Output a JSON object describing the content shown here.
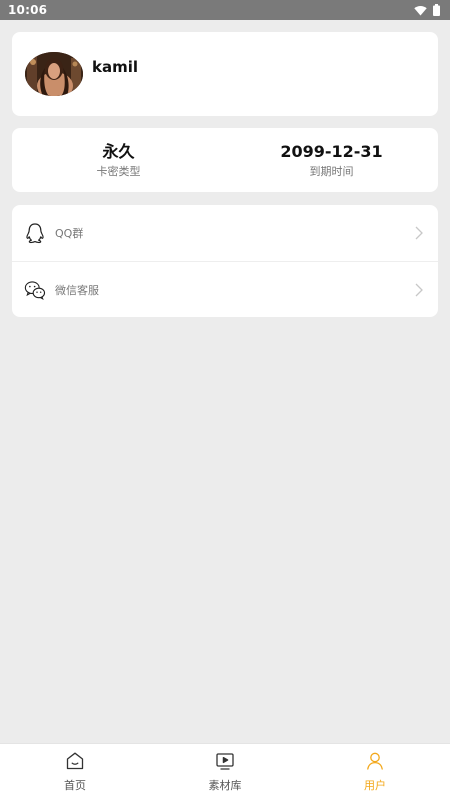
{
  "status_bar": {
    "time": "10:06"
  },
  "profile": {
    "username": "kamil"
  },
  "stats": [
    {
      "value": "永久",
      "label": "卡密类型"
    },
    {
      "value": "2099-12-31",
      "label": "到期时间"
    }
  ],
  "menu": [
    {
      "label": "QQ群",
      "icon": "qq-icon"
    },
    {
      "label": "微信客服",
      "icon": "wechat-icon"
    }
  ],
  "bottom_nav": [
    {
      "label": "首页",
      "icon": "home-icon",
      "active": false
    },
    {
      "label": "素材库",
      "icon": "video-library-icon",
      "active": false
    },
    {
      "label": "用户",
      "icon": "user-icon",
      "active": true
    }
  ],
  "colors": {
    "accent": "#f3a81b",
    "background": "#ececec",
    "card": "#ffffff"
  }
}
